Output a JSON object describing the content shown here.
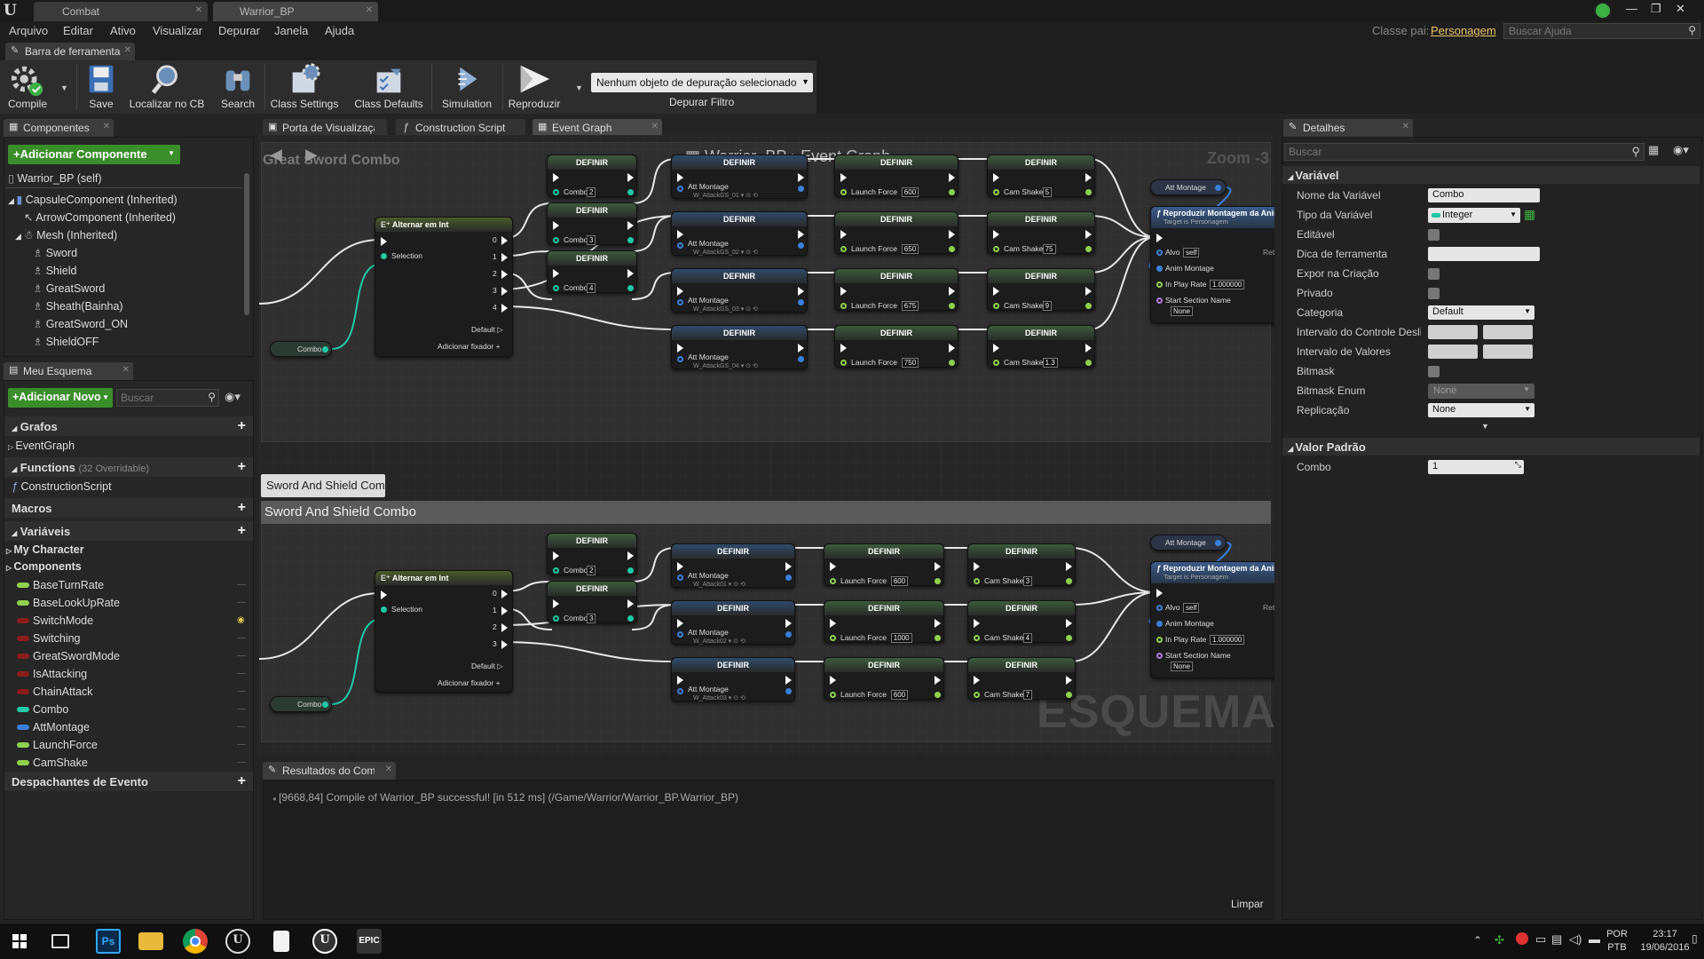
{
  "window": {
    "tabs": [
      "Combat",
      "Warrior_BP"
    ]
  },
  "menu": {
    "items": [
      "Arquivo",
      "Editar",
      "Ativo",
      "Visualizar",
      "Depurar",
      "Janela",
      "Ajuda"
    ],
    "parent_class_label": "Classe pai:",
    "parent_class_value": "Personagem",
    "help_search_placeholder": "Buscar Ajuda"
  },
  "toolbar": {
    "tab_label": "Barra de ferramentas",
    "buttons": [
      "Compile",
      "Save",
      "Localizar no CB",
      "Search",
      "Class Settings",
      "Class Defaults",
      "Simulation",
      "Reproduzir"
    ],
    "debug_select": "Nenhum objeto de depuração selecionado",
    "debug_filter_label": "Depurar Filtro"
  },
  "components": {
    "tab": "Componentes",
    "add_button": "+Adicionar Componente",
    "items": [
      "Warrior_BP (self)",
      "CapsuleComponent (Inherited)",
      "ArrowComponent (Inherited)",
      "Mesh (Inherited)",
      "Sword",
      "Shield",
      "GreatSword",
      "Sheath(Bainha)",
      "GreatSword_ON",
      "ShieldOFF"
    ]
  },
  "myblueprint": {
    "tab": "Meu Esquema",
    "add_button": "+Adicionar Novo",
    "search_placeholder": "Buscar",
    "graphs_label": "Grafos",
    "event_graph": "EventGraph",
    "functions_label": "Functions",
    "functions_count": "(32 Overridable)",
    "construction_script": "ConstructionScript",
    "macros_label": "Macros",
    "variables_label": "Variáveis",
    "var_categories": [
      "My Character",
      "Components"
    ],
    "variables": [
      {
        "name": "BaseTurnRate",
        "color": "#8fd14f"
      },
      {
        "name": "BaseLookUpRate",
        "color": "#8fd14f"
      },
      {
        "name": "SwitchMode",
        "color": "#8a1c1c"
      },
      {
        "name": "Switching",
        "color": "#8a1c1c"
      },
      {
        "name": "GreatSwordMode",
        "color": "#8a1c1c"
      },
      {
        "name": "IsAttacking",
        "color": "#8a1c1c"
      },
      {
        "name": "ChainAttack",
        "color": "#8a1c1c"
      },
      {
        "name": "Combo",
        "color": "#20c9a6"
      },
      {
        "name": "AttMontage",
        "color": "#3a7fd8"
      },
      {
        "name": "LaunchForce",
        "color": "#8fd14f"
      },
      {
        "name": "CamShake",
        "color": "#8fd14f"
      }
    ],
    "dispatchers_label": "Despachantes de Evento"
  },
  "editor_tabs": [
    "Porta de Visualização",
    "Construction Script",
    "Event Graph"
  ],
  "graph": {
    "breadcrumb_bp": "Warrior_BP",
    "breadcrumb_graph": "Event Graph",
    "zoom": "Zoom -3",
    "comment1": "Great Sword Combo",
    "comment2": "Sword And Shield Combo",
    "watermark": "ESQUEMA",
    "switch_title": "Alternar em Int",
    "selection": "Selection",
    "default": "Default",
    "add_pin": "Adicionar fixador",
    "set_title": "DEFINIR",
    "combo_var": "Combo",
    "att_montage": "Att Montage",
    "launch_force": "Launch Force",
    "cam_shake": "Cam Shake",
    "play_title": "Reproduzir Montagem da Anim",
    "play_target": "Target is Personagem",
    "alvo": "Alvo",
    "self": "self",
    "anim_montage": "Anim Montage",
    "play_rate": "In Play Rate",
    "play_rate_val": "1.000000",
    "start_section": "Start Section Name",
    "none": "None",
    "ret": "Ret",
    "top_combo_vals": [
      "2",
      "3",
      "4"
    ],
    "top_att_vals": [
      "W_AttackGS_01",
      "W_AttackGS_02",
      "W_AttackGS_03",
      "W_AttackGS_04"
    ],
    "top_launch_vals": [
      "600",
      "650",
      "675",
      "750"
    ],
    "top_cam_vals": [
      "5",
      "75",
      "9",
      "1.3"
    ],
    "bot_combo_vals": [
      "2",
      "3"
    ],
    "bot_att_vals": [
      "W_Attack01",
      "W_Attack02",
      "W_Attack03"
    ],
    "bot_launch_vals": [
      "600",
      "1000",
      "600"
    ],
    "bot_cam_vals": [
      "3",
      "4",
      "7"
    ],
    "top_switch_pins": [
      "0",
      "1",
      "2",
      "3",
      "4"
    ],
    "bot_switch_pins": [
      "0",
      "1",
      "2",
      "3"
    ]
  },
  "results": {
    "tab": "Resultados do Compilador",
    "message": "[9668,84] Compile of Warrior_BP successful! [in 512 ms] (/Game/Warrior/Warrior_BP.Warrior_BP)",
    "clear": "Limpar"
  },
  "details": {
    "tab": "Detalhes",
    "search_placeholder": "Buscar",
    "variable_section": "Variável",
    "rows": {
      "name_label": "Nome da Variável",
      "name_value": "Combo",
      "type_label": "Tipo da Variável",
      "type_value": "Integer",
      "editable": "Editável",
      "tooltip": "Dica de ferramenta",
      "expose": "Expor na Criação",
      "private": "Privado",
      "category_label": "Categoria",
      "category_value": "Default",
      "slider_range": "Intervalo do Controle Deslizante",
      "value_range": "Intervalo de Valores",
      "bitmask": "Bitmask",
      "bitmask_enum": "Bitmask Enum",
      "bitmask_enum_value": "None",
      "replication": "Replicação",
      "replication_value": "None"
    },
    "default_section": "Valor Padrão",
    "default_combo_label": "Combo",
    "default_combo_value": "1"
  },
  "tray": {
    "lang1": "POR",
    "lang2": "PTB",
    "time": "23:17",
    "date": "19/06/2016"
  }
}
